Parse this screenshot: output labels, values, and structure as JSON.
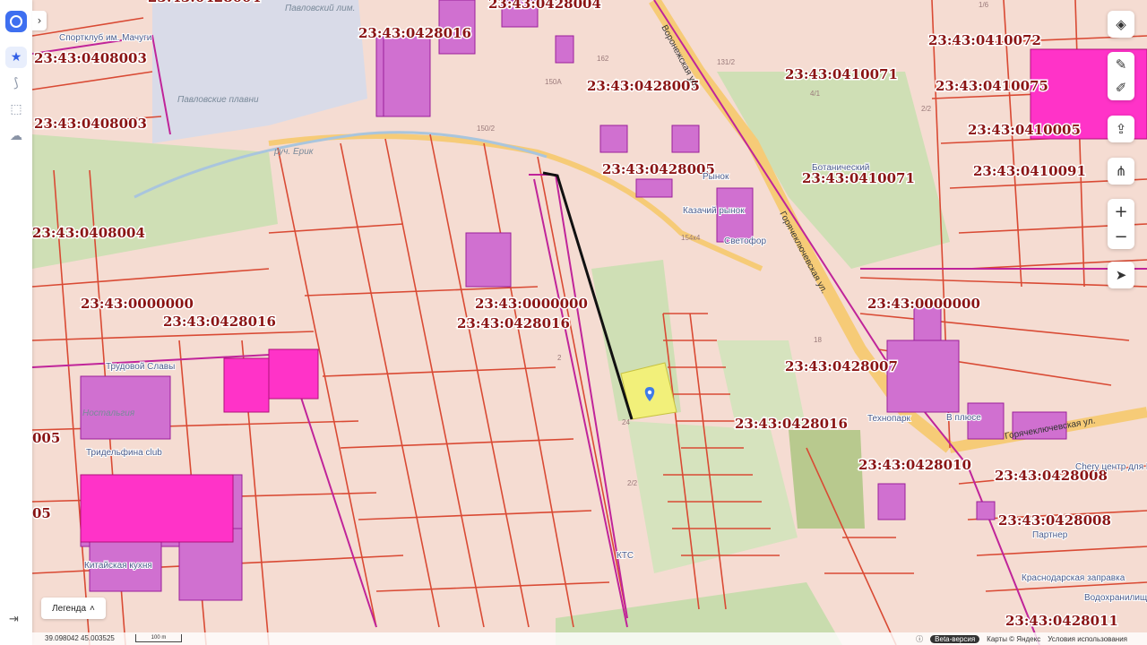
{
  "map": {
    "cadastral_labels": [
      "23:43:0428004",
      "23:43:0428016",
      "23:43:0408003",
      "23:43:0408003",
      "23:43:0428005",
      "23:43:0410072",
      "23:43:0410071",
      "23:43:0410075",
      "23:43:0410005",
      "23:43:0428005",
      "23:43:0410071",
      "23:43:0410091",
      "23:43:0408004",
      "23:43:0000000",
      "23:43:0428016",
      "23:43:0000000",
      "23:43:0428016",
      "23:43:0000000",
      "23:43:0428007",
      "23:43:0428016",
      "23:43:0428010",
      "23:43:0428008",
      "23:43:0428008",
      "23:43:0428011",
      "005",
      "05",
      "23:43:0428004"
    ],
    "pois": {
      "sportclub": "Спортклуб им. Мачуги",
      "pavlovsky": "Павловский лим.",
      "plavni": "Павловские плавни",
      "erik": "руч. Ерик",
      "botanical": "Ботанический",
      "market": "Рынок",
      "kazachy": "Казачий рынок",
      "svetofor": "Светофор",
      "technopark": "Технопарк",
      "v_plus": "В плюсе",
      "chery": "Chery центр для Вас",
      "partner": "Партнер",
      "krasnodar": "Краснодарская заправка",
      "vodohranilische": "Водохранилище",
      "kts": "КТС",
      "trudovaya": "Трудовой Славы",
      "delfina": "Тридельфина club",
      "kitchen": "Китайская кухня",
      "nostalgia": "Ностальгия"
    },
    "streets": {
      "voronezhskaya": "Воронежская ул.",
      "goryachekluchevskaya1": "Горячеключевская ул.",
      "goryachekluchevskaya2": "Горячеключевская ул."
    },
    "plot_numbers": [
      "150А",
      "150/2",
      "4/1",
      "131/2",
      "2/2",
      "162",
      "154к4",
      "2",
      "24",
      "2/2",
      "1/6",
      "18"
    ]
  },
  "sidebar": {
    "items": [
      "favorites-icon",
      "route-icon",
      "selection-icon",
      "cloud-icon"
    ],
    "logout": "logout-icon"
  },
  "controls": {
    "zoom_in": "+",
    "zoom_out": "−"
  },
  "legend": {
    "label": "Легенда"
  },
  "footer": {
    "coords": "39.098042  45.003525",
    "scale": "100 m",
    "beta": "Beta-версия",
    "maps": "Карты © Яндекс",
    "terms": "Условия использования"
  },
  "colors": {
    "parcel_line": "#d93a2b",
    "building": "#c93cc9",
    "highlight": "#ff33cc",
    "selected_parcel": "#f2f07a",
    "marker": "#3f7be8",
    "green": "#cfe0b0",
    "road": "#f7cf7a"
  }
}
